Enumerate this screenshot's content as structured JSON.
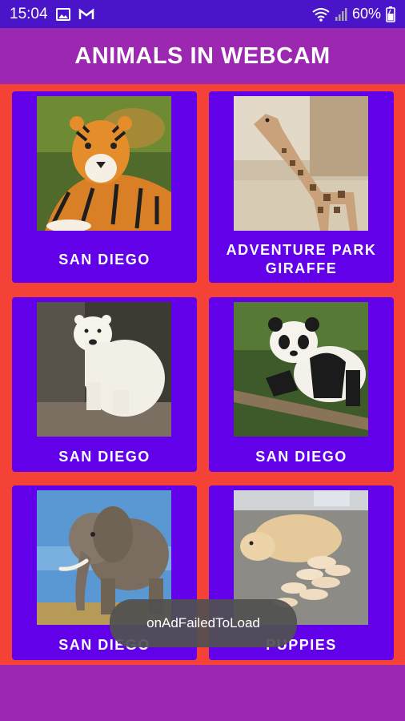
{
  "status_bar": {
    "time": "15:04",
    "battery": "60%",
    "icons": [
      "image-icon",
      "gmail-icon",
      "wifi-icon",
      "signal-icon",
      "battery-icon"
    ]
  },
  "app_bar": {
    "title": "ANIMALS IN WEBCAM"
  },
  "cards": [
    {
      "label": "SAN DIEGO",
      "image": "tiger"
    },
    {
      "label": "ADVENTURE PARK GIRAFFE",
      "image": "giraffe"
    },
    {
      "label": "SAN DIEGO",
      "image": "polar-bear"
    },
    {
      "label": "SAN DIEGO",
      "image": "panda"
    },
    {
      "label": "SAN DIEGO",
      "image": "elephant"
    },
    {
      "label": "PUPPIES",
      "image": "puppies"
    }
  ],
  "toast": {
    "text": "onAdFailedToLoad"
  },
  "colors": {
    "status_bar": "#4a14c8",
    "app_bar": "#9c27b0",
    "background": "#f44336",
    "card": "#6200ea"
  }
}
